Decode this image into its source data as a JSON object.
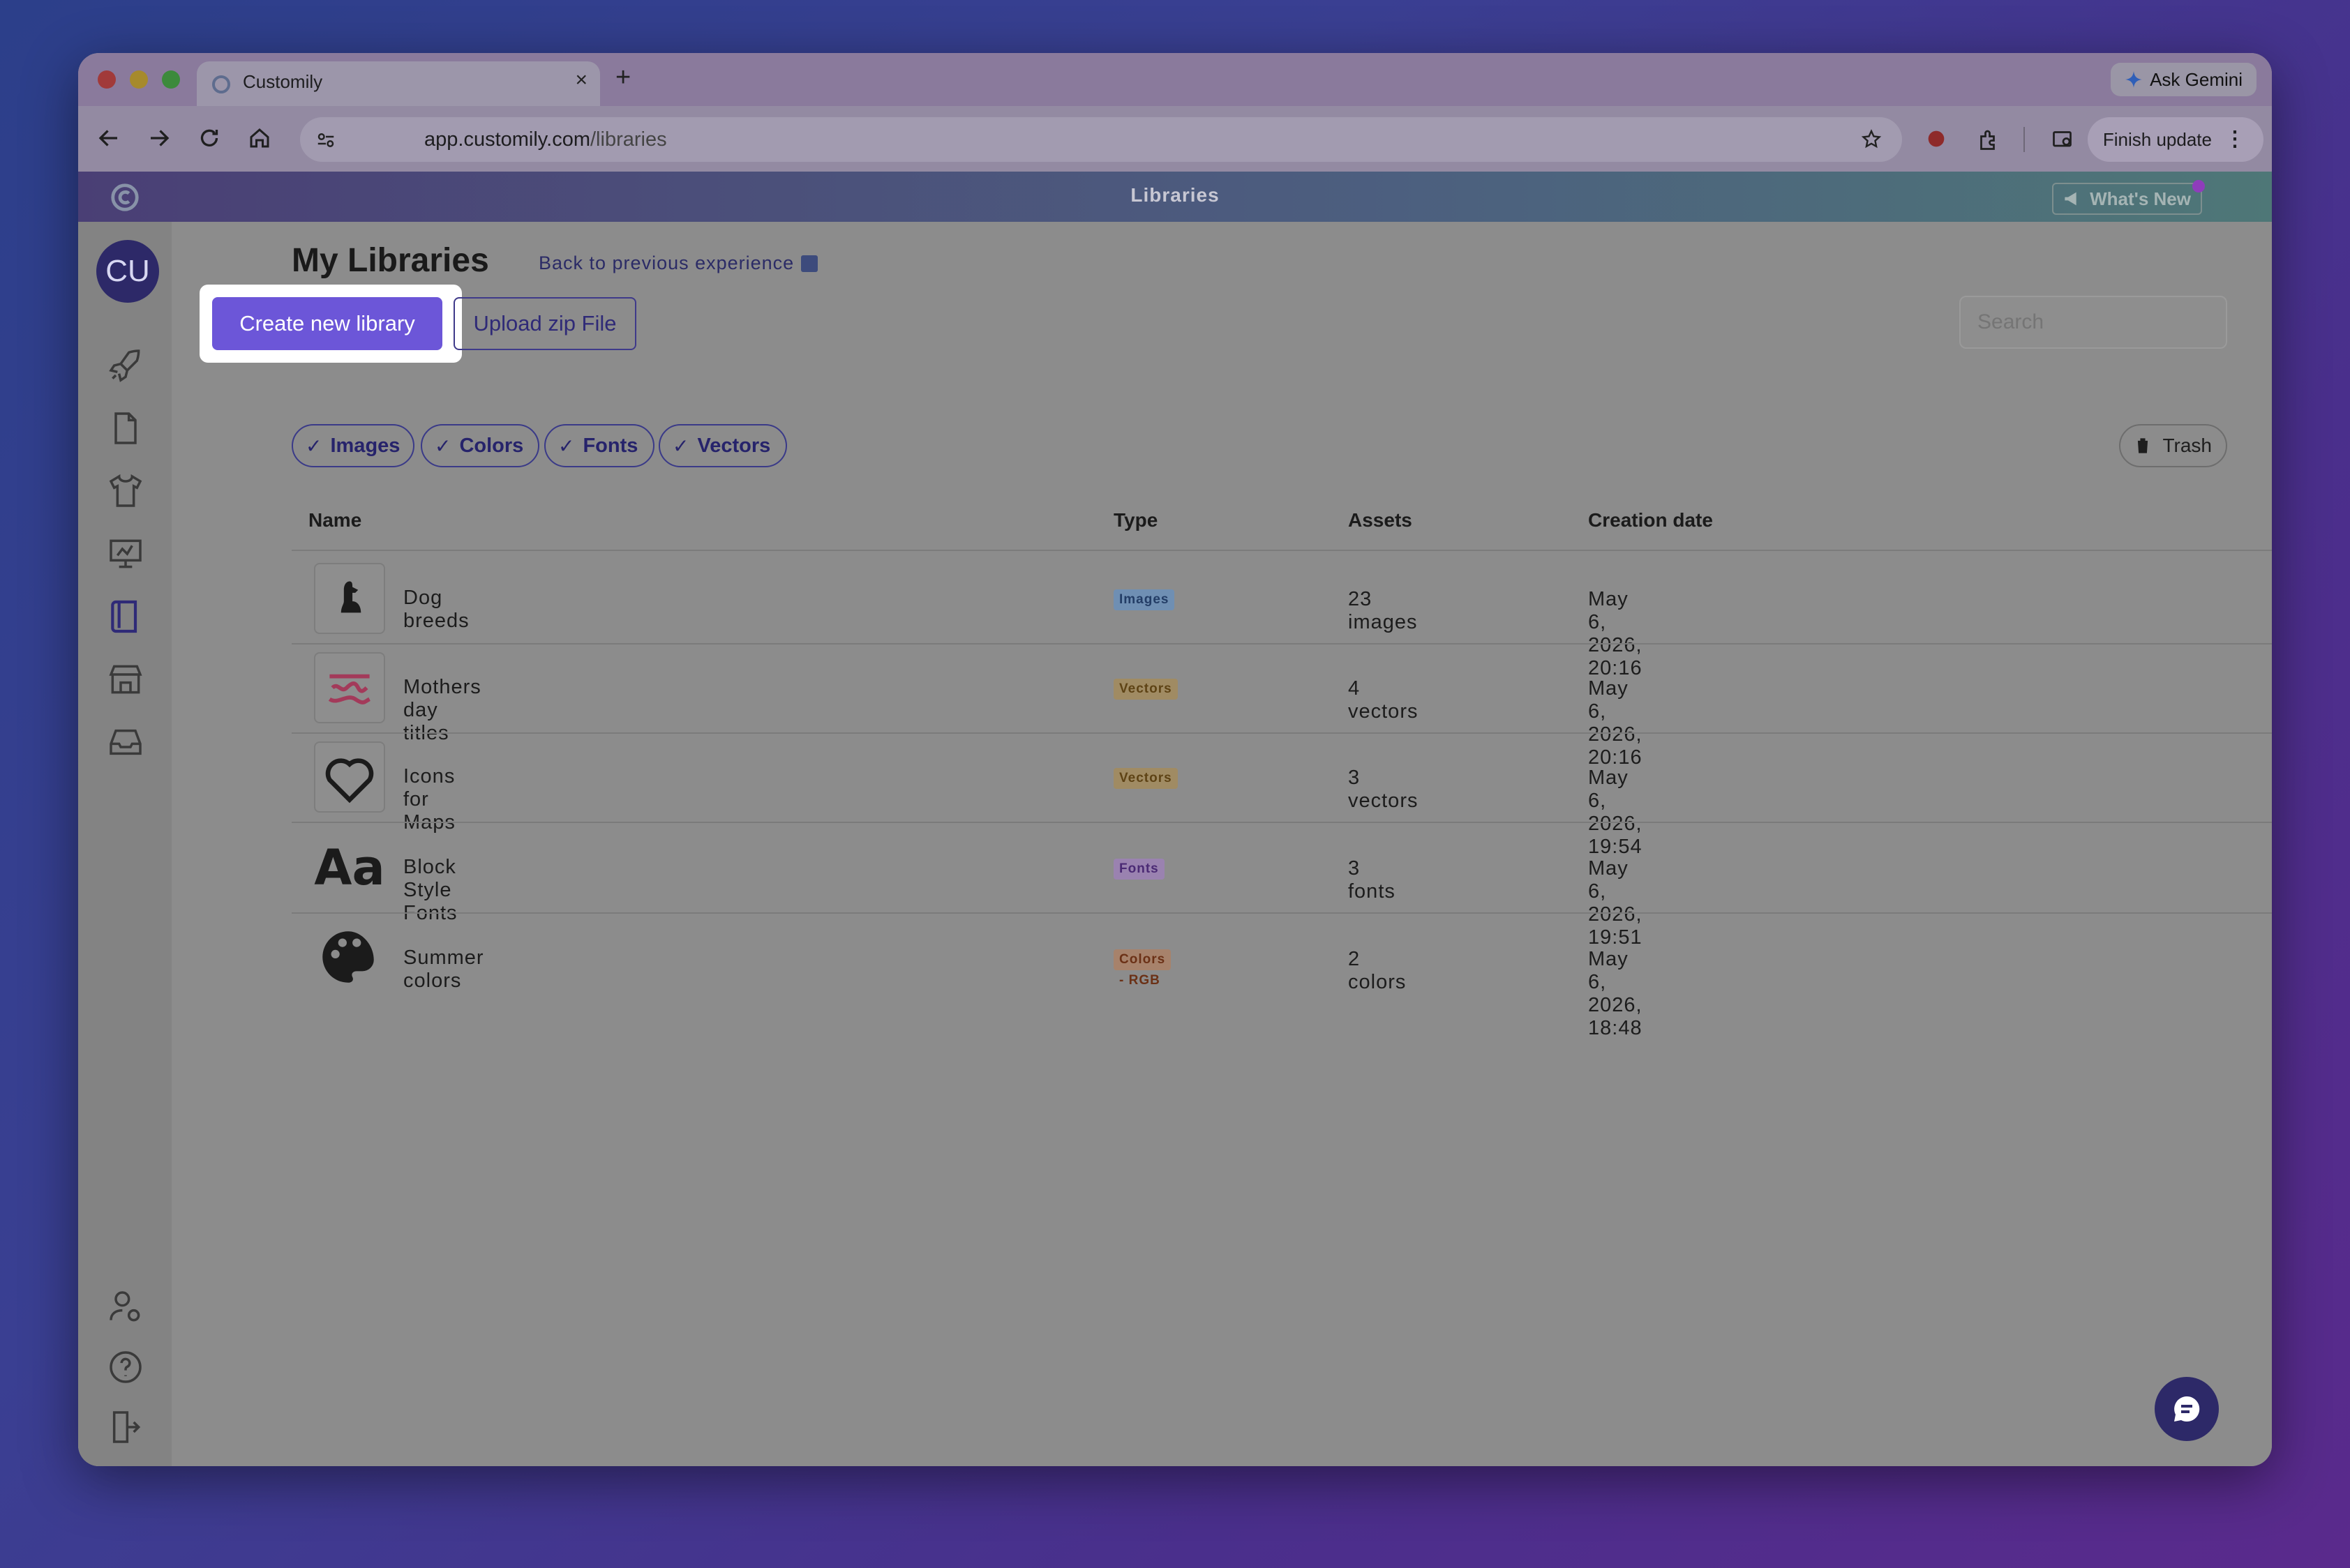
{
  "browser": {
    "tab_title": "Customily",
    "tab_close": "×",
    "new_tab": "+",
    "ask_gemini": "Ask Gemini",
    "url_host": "app.customily.com",
    "url_path": "/libraries",
    "finish_update": "Finish update"
  },
  "header": {
    "title": "Libraries",
    "whats_new": "What's New"
  },
  "sidebar": {
    "avatar_initials": "CU",
    "items": [
      "rocket-icon",
      "document-icon",
      "tshirt-icon",
      "presentation-icon",
      "book-icon",
      "store-icon",
      "inbox-icon"
    ],
    "bottom_items": [
      "user-settings-icon",
      "help-icon",
      "logout-icon"
    ]
  },
  "main": {
    "heading": "My Libraries",
    "back_link": "Back to previous experience",
    "create_button": "Create new library",
    "upload_button": "Upload zip File",
    "search_placeholder": "Search",
    "trash_label": "Trash",
    "filters": [
      {
        "label": "Images",
        "checked": true
      },
      {
        "label": "Colors",
        "checked": true
      },
      {
        "label": "Fonts",
        "checked": true
      },
      {
        "label": "Vectors",
        "checked": true
      }
    ],
    "columns": [
      "Name",
      "Type",
      "Assets",
      "Creation date"
    ],
    "rows": [
      {
        "name": "Dog breeds",
        "type": "Images",
        "assets": "23 images",
        "date": "May 6, 2026, 20:16",
        "badge_bg": "#6f8fb3",
        "badge_fg": "#233d66"
      },
      {
        "name": "Mothers day titles",
        "type": "Vectors",
        "assets": "4 vectors",
        "date": "May 6, 2026, 20:16",
        "badge_bg": "#a08b63",
        "badge_fg": "#5e4315"
      },
      {
        "name": "Icons for Maps",
        "type": "Vectors",
        "assets": "3 vectors",
        "date": "May 6, 2026, 19:54",
        "badge_bg": "#a08b63",
        "badge_fg": "#5e4315"
      },
      {
        "name": "Block Style Fonts",
        "type": "Fonts",
        "assets": "3 fonts",
        "date": "May 6, 2026, 19:51",
        "badge_bg": "#9a82b0",
        "badge_fg": "#4b2a74"
      },
      {
        "name": "Summer colors",
        "type": "Colors - RGB",
        "assets": "2 colors",
        "date": "May 6, 2026, 18:48",
        "badge_bg": "#a7826b",
        "badge_fg": "#6b3116"
      }
    ],
    "font_thumb_text": "Aa"
  },
  "colors": {
    "accent": "#6c56d8",
    "brand_dark": "#2d2968"
  }
}
